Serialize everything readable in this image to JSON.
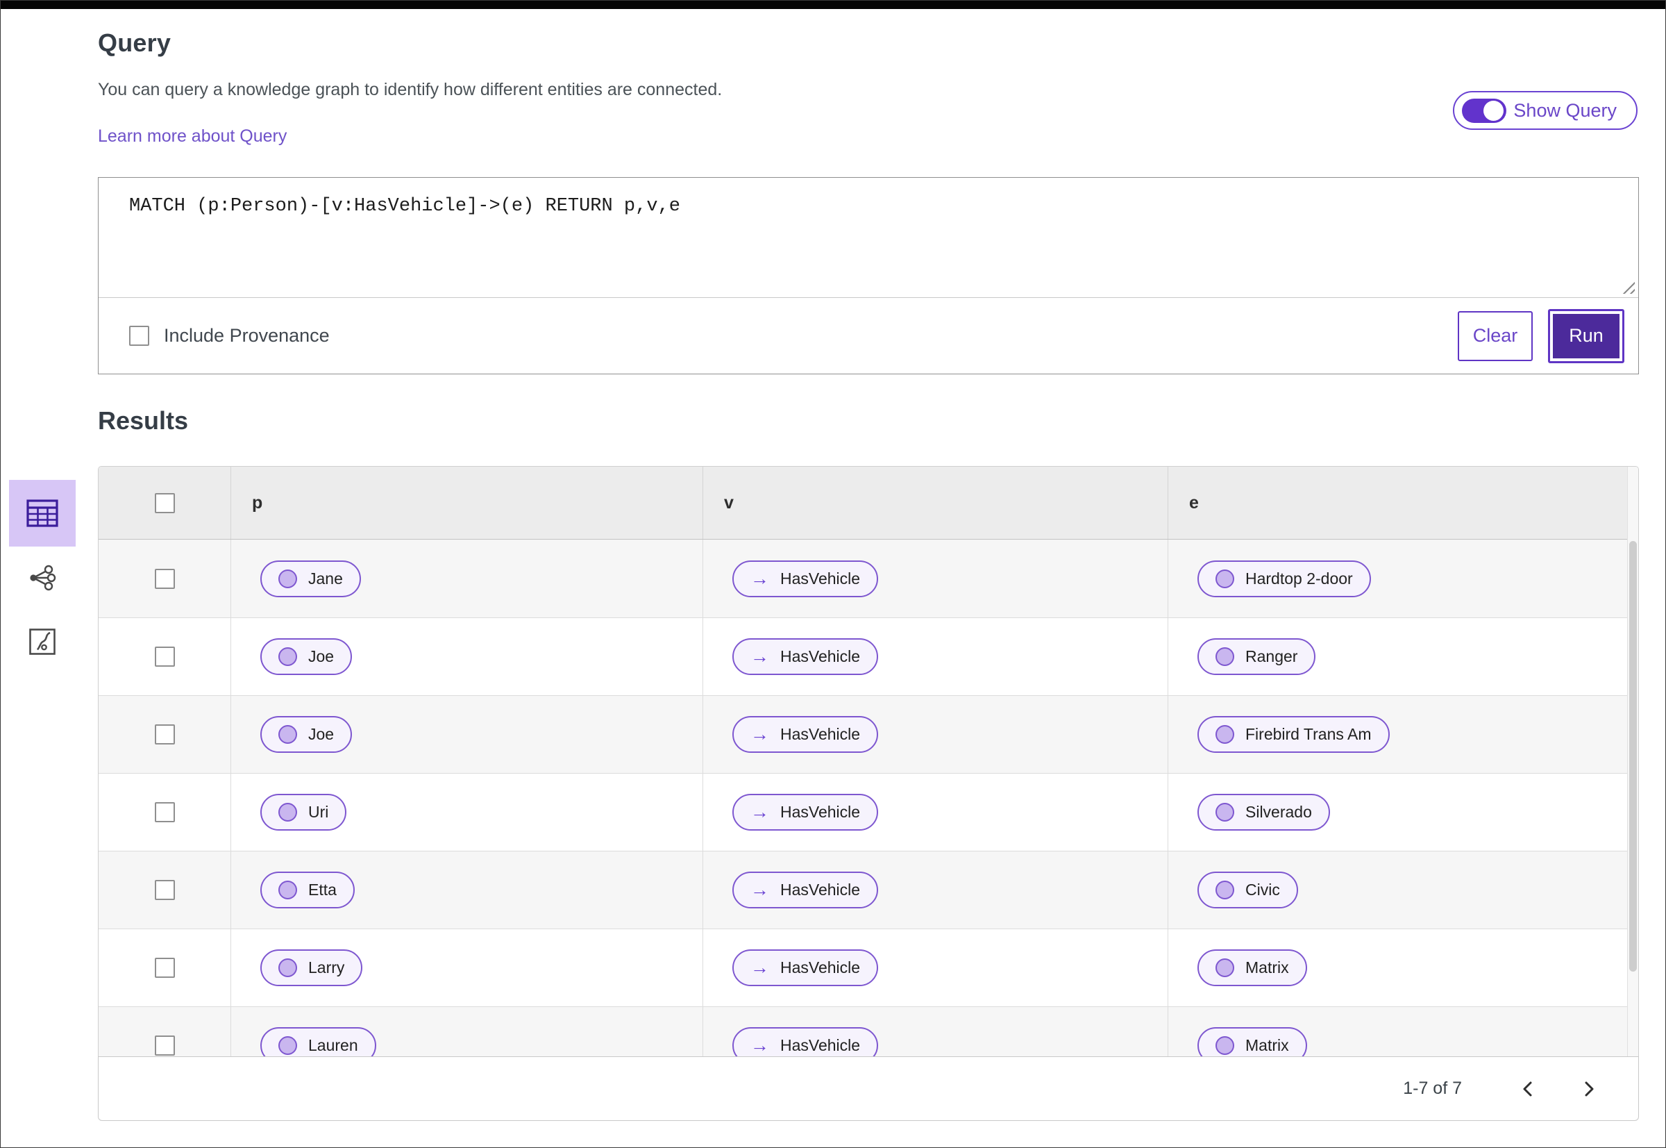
{
  "header": {
    "title": "Query",
    "description": "You can query a knowledge graph to identify how different entities are connected.",
    "learn_more_link": "Learn more about Query",
    "show_query_label": "Show Query",
    "show_query_state": "on"
  },
  "query_editor": {
    "query_text": "MATCH (p:Person)-[v:HasVehicle]->(e) RETURN p,v,e",
    "include_provenance_label": "Include Provenance",
    "include_provenance_checked": false,
    "clear_button_label": "Clear",
    "run_button_label": "Run"
  },
  "results": {
    "title": "Results",
    "view_switcher": [
      {
        "icon": "table-view-icon",
        "label": "table view",
        "active": true
      },
      {
        "icon": "graph-view-icon",
        "label": "graph view",
        "active": false
      },
      {
        "icon": "chart-view-icon",
        "label": "chart view",
        "active": false
      }
    ],
    "table": {
      "columns": [
        "p",
        "v",
        "e"
      ],
      "arrow_glyph": "→",
      "rows": [
        {
          "p": "Jane",
          "v": "HasVehicle",
          "e": "Hardtop 2-door"
        },
        {
          "p": "Joe",
          "v": "HasVehicle",
          "e": "Ranger"
        },
        {
          "p": "Joe",
          "v": "HasVehicle",
          "e": "Firebird Trans Am"
        },
        {
          "p": "Uri",
          "v": "HasVehicle",
          "e": "Silverado"
        },
        {
          "p": "Etta",
          "v": "HasVehicle",
          "e": "Civic"
        },
        {
          "p": "Larry",
          "v": "HasVehicle",
          "e": "Matrix"
        },
        {
          "p": "Lauren",
          "v": "HasVehicle",
          "e": "Matrix"
        }
      ]
    },
    "pagination": {
      "range_text": "1-7 of 7",
      "prev_icon": "chevron-left",
      "next_icon": "chevron-right"
    }
  },
  "colors": {
    "accent_purple": "#6a43d2",
    "run_button_fill": "#4c2a9b",
    "active_view_bg": "#d7c6f6",
    "pill_border": "#7e57d0",
    "pill_bg": "#f6f3fd",
    "node_fill": "#c9b6ef",
    "link": "#6f52c9",
    "header_row_bg": "#ececec",
    "zebra_row_bg": "#f6f6f6"
  }
}
